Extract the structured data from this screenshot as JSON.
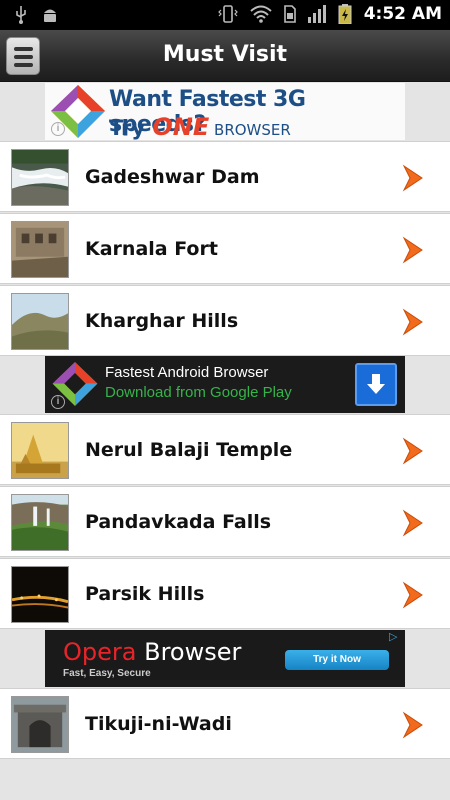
{
  "status_bar": {
    "time": "4:52 AM",
    "icons": [
      "usb-icon",
      "android-icon",
      "vibrate-icon",
      "wifi-icon",
      "sim-icon",
      "signal-icon",
      "battery-icon"
    ]
  },
  "header": {
    "title": "Must Visit",
    "menu_icon": "menu-icon"
  },
  "ads": {
    "top": {
      "line1": "Want Fastest 3G speeds?",
      "line2_prefix": "Try ",
      "line2_brand": "ONE",
      "line2_suffix": " BROWSER"
    },
    "middle": {
      "title": "Fastest Android Browser",
      "subtitle": "Download from Google Play"
    },
    "bottom": {
      "brand_red": "Opera",
      "brand_white": " Browser",
      "tagline": "Fast, Easy, Secure",
      "cta": "Try it Now"
    }
  },
  "places": [
    {
      "name": "Gadeshwar Dam",
      "thumb": "waterfall-rocks"
    },
    {
      "name": "Karnala Fort",
      "thumb": "rock-fort"
    },
    {
      "name": "Kharghar Hills",
      "thumb": "green-hills"
    },
    {
      "name": "Nerul Balaji Temple",
      "thumb": "temple"
    },
    {
      "name": "Pandavkada Falls",
      "thumb": "falls"
    },
    {
      "name": "Parsik Hills",
      "thumb": "night-lights"
    },
    {
      "name": "Tikuji-ni-Wadi",
      "thumb": "stone-gate"
    }
  ],
  "colors": {
    "accent_arrow": "#f26a1b",
    "title_bar": "#2a2a2a"
  }
}
